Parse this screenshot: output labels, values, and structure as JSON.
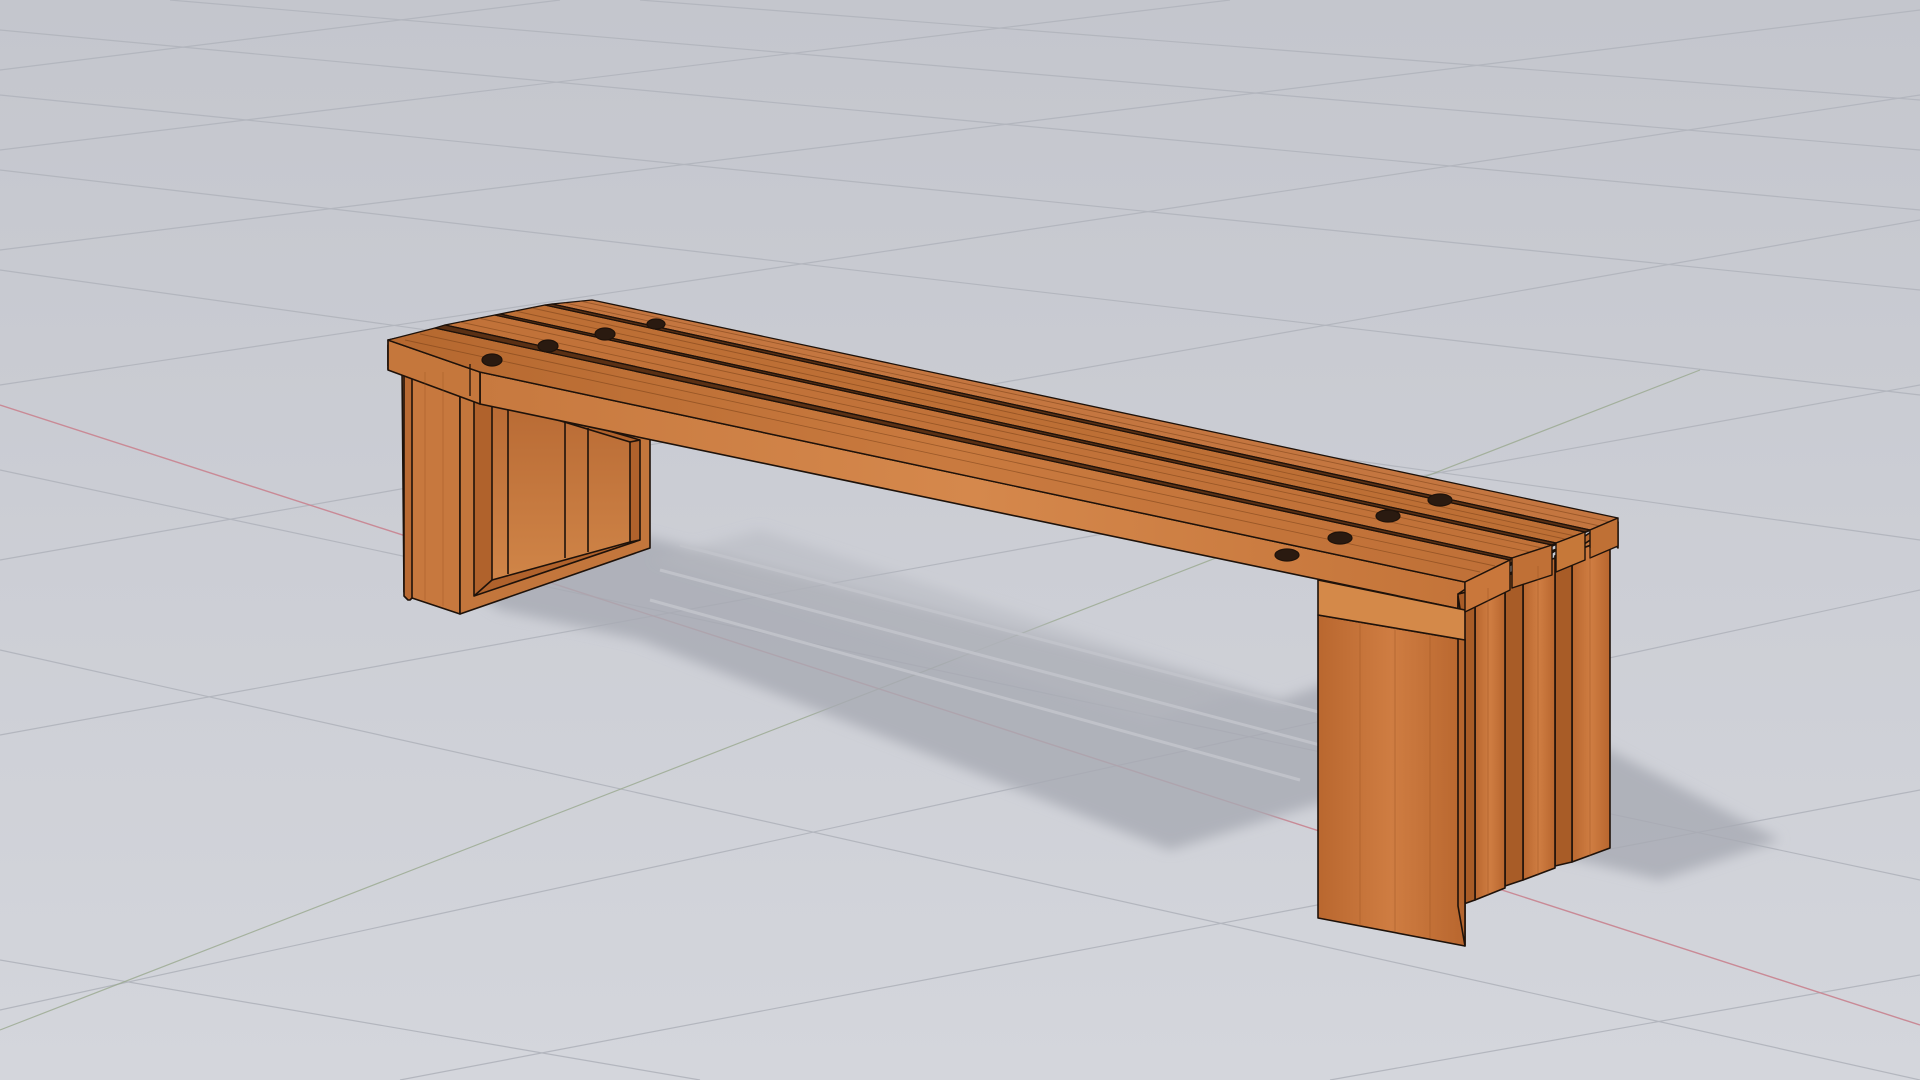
{
  "scene": {
    "subject": "wooden-bench",
    "background_color": "#c9cbd2",
    "grid_line_color": "#b2b5bd",
    "x_axis_color": "#c98a96",
    "y_axis_color": "#9aa98f",
    "wood_light": "#d8894d",
    "wood_mid": "#c27338",
    "wood_dark": "#9a5423",
    "edge_color": "#1e120a",
    "shadow_color": "#a4a7b0"
  }
}
